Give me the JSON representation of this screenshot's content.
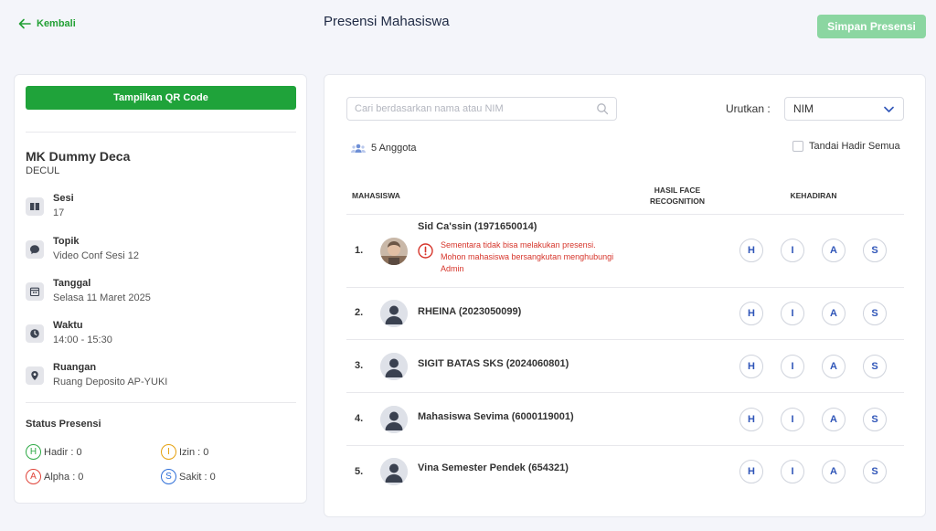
{
  "header": {
    "back_label": "Kembali",
    "title": "Presensi Mahasiswa",
    "save_label": "Simpan Presensi"
  },
  "sidebar": {
    "qr_button": "Tampilkan QR Code",
    "course_name": "MK Dummy Deca",
    "course_code": "DECUL",
    "info": [
      {
        "label": "Sesi",
        "value": "17",
        "icon": "book-icon"
      },
      {
        "label": "Topik",
        "value": "Video Conf Sesi 12",
        "icon": "chat-icon"
      },
      {
        "label": "Tanggal",
        "value": "Selasa 11 Maret 2025",
        "icon": "calendar-icon"
      },
      {
        "label": "Waktu",
        "value": "14:00 - 15:30",
        "icon": "clock-icon"
      },
      {
        "label": "Ruangan",
        "value": "Ruang Deposito AP-YUKI",
        "icon": "location-icon"
      }
    ],
    "status_title": "Status Presensi",
    "status": [
      {
        "letter": "H",
        "label": "Hadir : 0",
        "color": "#2eaa46"
      },
      {
        "letter": "I",
        "label": "Izin : 0",
        "color": "#e5a00d"
      },
      {
        "letter": "A",
        "label": "Alpha : 0",
        "color": "#e0443a"
      },
      {
        "letter": "S",
        "label": "Sakit : 0",
        "color": "#2f6fd8"
      }
    ]
  },
  "main": {
    "search_placeholder": "Cari berdasarkan nama atau NIM",
    "sort_label": "Urutkan :",
    "sort_value": "NIM",
    "member_count": "5 Anggota",
    "mark_all_label": "Tandai Hadir Semua",
    "columns": {
      "student": "MAHASISWA",
      "face": "HASIL FACE RECOGNITION",
      "attendance": "KEHADIRAN"
    },
    "attendance_options": [
      "H",
      "I",
      "A",
      "S"
    ],
    "students": [
      {
        "no": "1.",
        "name": "Sid Ca'ssin (1971650014)",
        "warning": "Sementara tidak bisa melakukan presensi. Mohon mahasiswa bersangkutan menghubungi Admin",
        "photo": true
      },
      {
        "no": "2.",
        "name": "RHEINA (2023050099)",
        "warning": "",
        "photo": false
      },
      {
        "no": "3.",
        "name": "SIGIT BATAS SKS (2024060801)",
        "warning": "",
        "photo": false
      },
      {
        "no": "4.",
        "name": "Mahasiswa Sevima (6000119001)",
        "warning": "",
        "photo": false
      },
      {
        "no": "5.",
        "name": "Vina Semester Pendek (654321)",
        "warning": "",
        "photo": false
      }
    ]
  },
  "colors": {
    "primary_green": "#1fa33a",
    "disabled_green": "#8bd6a1",
    "attendance_blue": "#2f55b8",
    "warning_red": "#d6352b"
  }
}
